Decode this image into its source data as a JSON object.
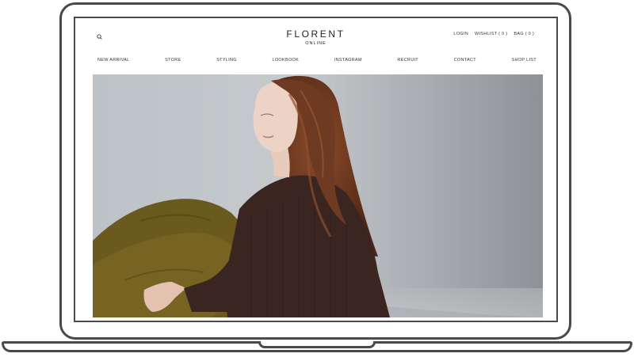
{
  "site": {
    "logo": "FLORENT",
    "logo_sub": "ONLINE"
  },
  "util_nav": {
    "login": "LOGIN",
    "wishlist": "WISHLIST ( 0 )",
    "bag": "BAG ( 0 )"
  },
  "main_nav": [
    {
      "label": "NEW ARRIVAL"
    },
    {
      "label": "STORE"
    },
    {
      "label": "STYLING"
    },
    {
      "label": "LOOKBOOK"
    },
    {
      "label": "INSTAGRAM"
    },
    {
      "label": "RECRUIT"
    },
    {
      "label": "CONTACT"
    },
    {
      "label": "SHOP LIST"
    }
  ],
  "icons": {
    "search": "search-icon"
  },
  "colors": {
    "frame": "#4a4a4a",
    "backdrop": "#b9bfc4",
    "knit": "#3a2521",
    "trousers": "#6b5a1e",
    "hair": "#6e3a22"
  }
}
